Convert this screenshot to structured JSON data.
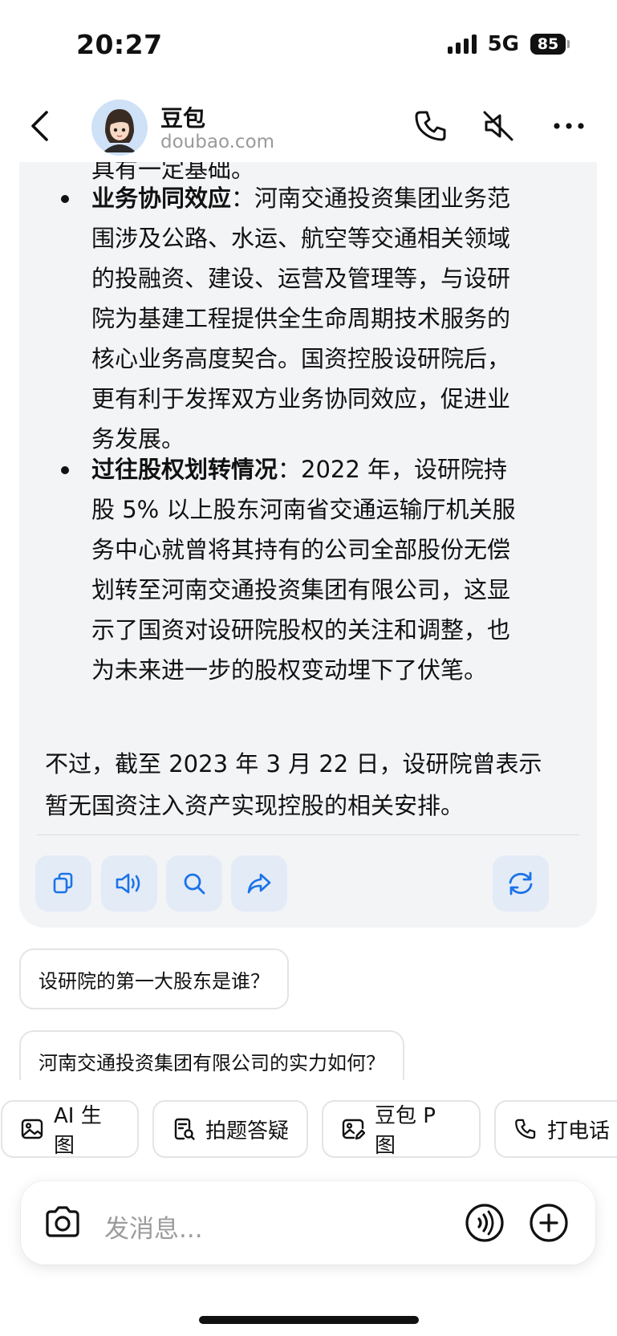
{
  "status_bar": {
    "time": "20:27",
    "network": "5G",
    "battery": "85"
  },
  "header": {
    "bot_name": "豆包",
    "bot_domain": "doubao.com",
    "icons": [
      "back-icon",
      "phone-icon",
      "mute-icon",
      "more-icon"
    ]
  },
  "message": {
    "cut_line": "具有一定基础。",
    "bullets": [
      {
        "title": "业务协同效应",
        "lines": [
          "：河南交通投资集团业务范",
          "围涉及公路、水运、航空等交通相关领域",
          "的投融资、建设、运营及管理等，与设研",
          "院为基建工程提供全生命周期技术服务的",
          "核心业务高度契合。国资控股设研院后，",
          "更有利于发挥双方业务协同效应，促进业",
          "务发展。"
        ]
      },
      {
        "title": "过往股权划转情况",
        "lines": [
          "：2022 年，设研院持",
          "股 5% 以上股东河南省交通运输厅机关服",
          "务中心就曾将其持有的公司全部股份无偿",
          "划转至河南交通投资集团有限公司，这显",
          "示了国资对设研院股权的关注和调整，也",
          "为未来进一步的股权变动埋下了伏笔。"
        ]
      }
    ],
    "closing_lines": [
      "不过，截至 2023 年 3 月 22 日，设研院曾表示",
      "暂无国资注入资产实现控股的相关安排。"
    ],
    "toolbar_icons": [
      "copy-icon",
      "speaker-icon",
      "search-icon",
      "share-icon",
      "regenerate-icon"
    ]
  },
  "suggestions": [
    "设研院的第一大股东是谁？",
    "河南交通投资集团有限公司的实力如何？"
  ],
  "quick_actions": [
    {
      "label": "AI 生图",
      "icon": "image-icon"
    },
    {
      "label": "拍题答疑",
      "icon": "scan-question-icon"
    },
    {
      "label": "豆包 P 图",
      "icon": "photo-edit-icon"
    },
    {
      "label": "打电话",
      "icon": "phone-icon"
    }
  ],
  "composer": {
    "placeholder": "发消息...",
    "icons": [
      "camera-icon",
      "voice-icon",
      "plus-icon"
    ]
  },
  "colors": {
    "accent": "#1a73e8",
    "tool_bg": "#e3ebf7",
    "card_bg": "#f3f4f6"
  }
}
